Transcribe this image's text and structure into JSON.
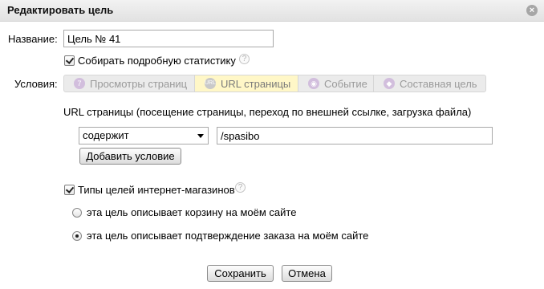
{
  "dialog": {
    "title": "Редактировать цель",
    "close_icon": "×"
  },
  "name": {
    "label": "Название:",
    "value": "Цель № 41"
  },
  "detailed_stats": {
    "label": "Собирать подробную статистику",
    "checked": true
  },
  "conditions": {
    "label": "Условия:",
    "tabs": [
      {
        "label": "Просмотры страниц",
        "icon": "page-views-icon",
        "active": false
      },
      {
        "label": "URL страницы",
        "icon": "url-icon",
        "active": true
      },
      {
        "label": "Событие",
        "icon": "event-icon",
        "active": false
      },
      {
        "label": "Составная цель",
        "icon": "composite-goal-icon",
        "active": false
      }
    ]
  },
  "url_section": {
    "description": "URL страницы (посещение страницы, переход по внешней ссылке, загрузка файла)",
    "match_type": "содержит",
    "url_value": "/spasibo",
    "add_condition_label": "Добавить условие"
  },
  "ecommerce": {
    "label": "Типы целей интернет-магазинов",
    "checked": true,
    "options": [
      {
        "label": "эта цель описывает корзину на моём сайте",
        "selected": false
      },
      {
        "label": "эта цель описывает подтверждение заказа на моём сайте",
        "selected": true
      }
    ]
  },
  "footer": {
    "save_label": "Сохранить",
    "cancel_label": "Отмена"
  },
  "colors": {
    "active_tab": "#fff7c7",
    "tab_bar": "#ebebeb",
    "title_bar": "#e8e8e8",
    "tab_icon": "#d2bedd"
  }
}
